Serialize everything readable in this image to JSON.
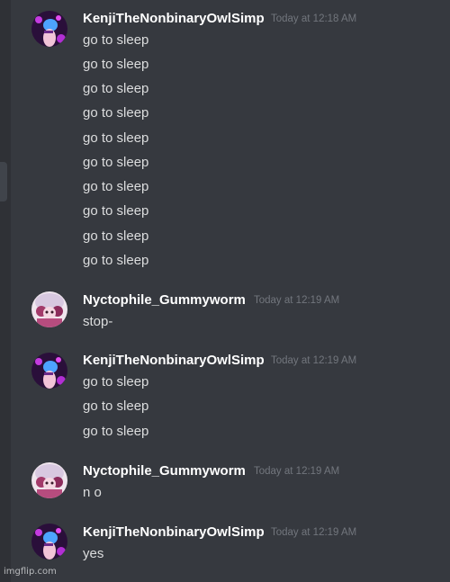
{
  "messages": [
    {
      "author": "KenjiTheNonbinaryOwlSimp",
      "avatar": "kenji-avatar-icon",
      "timestamp": "Today at 12:18 AM",
      "lines": [
        "go to sleep",
        "go to sleep",
        "go to sleep",
        "go to sleep",
        "go to sleep",
        "go to sleep",
        "go to sleep",
        "go to sleep",
        "go to sleep",
        "go to sleep"
      ]
    },
    {
      "author": "Nyctophile_Gummyworm",
      "avatar": "nyctophile-avatar-icon",
      "timestamp": "Today at 12:19 AM",
      "lines": [
        "stop-"
      ]
    },
    {
      "author": "KenjiTheNonbinaryOwlSimp",
      "avatar": "kenji-avatar-icon",
      "timestamp": "Today at 12:19 AM",
      "lines": [
        "go to sleep",
        "go to sleep",
        "go to sleep"
      ]
    },
    {
      "author": "Nyctophile_Gummyworm",
      "avatar": "nyctophile-avatar-icon",
      "timestamp": "Today at 12:19 AM",
      "lines": [
        "n o"
      ]
    },
    {
      "author": "KenjiTheNonbinaryOwlSimp",
      "avatar": "kenji-avatar-icon",
      "timestamp": "Today at 12:19 AM",
      "lines": [
        "yes"
      ]
    }
  ],
  "watermark": "imgflip.com",
  "colors": {
    "background": "#36393f",
    "username": "#ffffff",
    "message_text": "#dcddde",
    "timestamp": "#72767d"
  }
}
